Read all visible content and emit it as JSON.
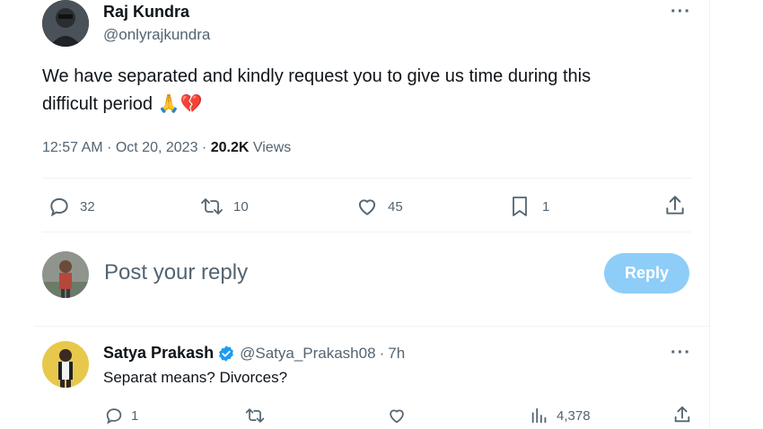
{
  "tweet": {
    "author_name": "Raj Kundra",
    "author_handle": "@onlyrajkundra",
    "text_line1": "We have separated and kindly request you to give us time during this",
    "text_line2": "difficult period",
    "emoji": "🙏💔",
    "time": "12:57 AM",
    "date": "Oct 20, 2023",
    "views_count": "20.2K",
    "views_label": "Views",
    "replies": "32",
    "reposts": "10",
    "likes": "45",
    "bookmarks": "1"
  },
  "composer": {
    "placeholder": "Post your reply",
    "reply_label": "Reply"
  },
  "reply": {
    "author_name": "Satya Prakash",
    "author_handle": "@Satya_Prakash08",
    "age": "7h",
    "text": "Separat means? Divorces?",
    "replies": "1",
    "views": "4,378"
  },
  "colors": {
    "accent": "#1d9bf0",
    "reply_button": "#8ecdf8",
    "muted": "#536471"
  },
  "icons": [
    "reply-icon",
    "repost-icon",
    "like-icon",
    "bookmark-icon",
    "share-icon",
    "analytics-icon",
    "verified-icon",
    "more-icon"
  ]
}
